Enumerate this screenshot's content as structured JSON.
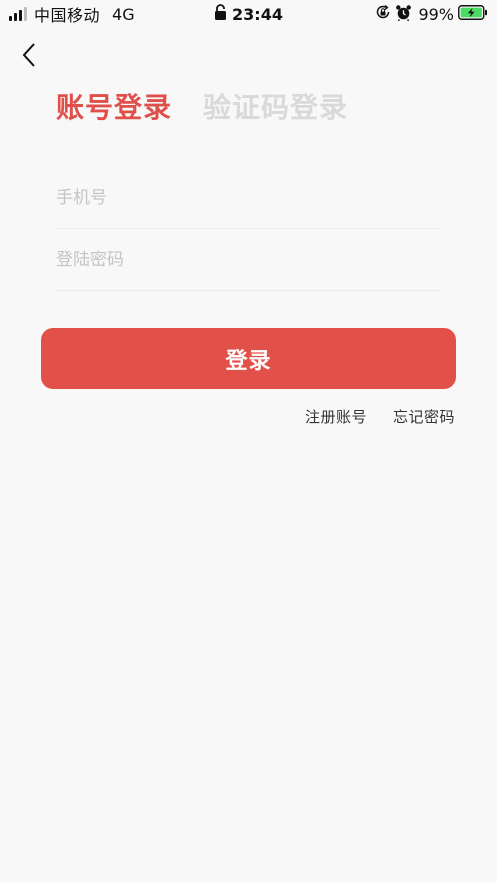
{
  "status_bar": {
    "carrier": "中国移动",
    "network": "4G",
    "time": "23:44",
    "battery_percent": "99%",
    "icons": [
      "signal-icon",
      "lock-icon",
      "rotation-lock-icon",
      "alarm-icon",
      "battery-charging-icon"
    ],
    "battery_color": "#4cd964"
  },
  "nav": {
    "back_icon": "chevron-left-icon"
  },
  "tabs": [
    {
      "label": "账号登录",
      "active": true
    },
    {
      "label": "验证码登录",
      "active": false
    }
  ],
  "form": {
    "phone_placeholder": "手机号",
    "phone_value": "",
    "password_placeholder": "登陆密码",
    "password_value": ""
  },
  "login_button": {
    "label": "登录"
  },
  "links": {
    "register": "注册账号",
    "forgot": "忘记密码"
  },
  "colors": {
    "accent": "#e2504a",
    "background": "#f8f8f8",
    "inactive_tab": "#d9d9d9"
  }
}
